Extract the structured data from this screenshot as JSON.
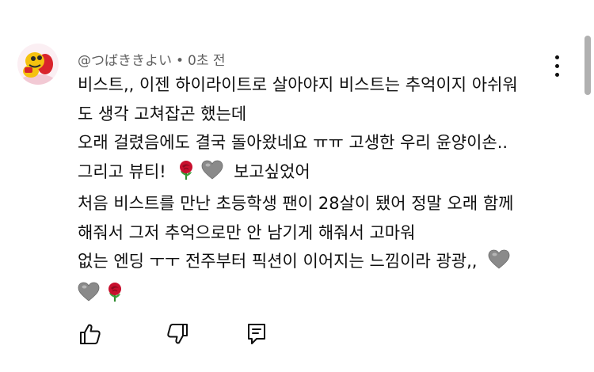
{
  "comment": {
    "author": "@つばききよい",
    "separator": "•",
    "timestamp": "0초 전",
    "lines": [
      "비스트,, 이젠 하이라이트로 살아야지 비스트는 추억이지 아쉬워",
      "도 생각 고쳐잡곤 했는데",
      "오래 걸렸음에도 결국 돌아왔네요 ㅠㅠ 고생한 우리 윤양이손..",
      "그리고 뷰티!",
      "보고싶었어",
      "처음 비스트를 만난 초등학생 팬이 28살이 됐어 정말 오래 함께",
      "해줘서 그저 추억으로만 안 남기게 해줘서 고마워",
      "없는 엔딩 ㅜㅜ 전주부터 픽션이 이어지는 느낌이라 광광,,"
    ],
    "emojis": {
      "rose": "rose-emoji",
      "grey_heart": "grey-heart-emoji"
    }
  },
  "icons": {
    "avatar": "avatar-image",
    "menu": "kebab-menu-icon",
    "like": "thumbs-up-icon",
    "dislike": "thumbs-down-icon",
    "reply": "reply-icon"
  },
  "colors": {
    "text": "#0f0f0f",
    "meta": "#606060",
    "rose": "#c8102e",
    "grey_heart": "#8a8a8a"
  }
}
